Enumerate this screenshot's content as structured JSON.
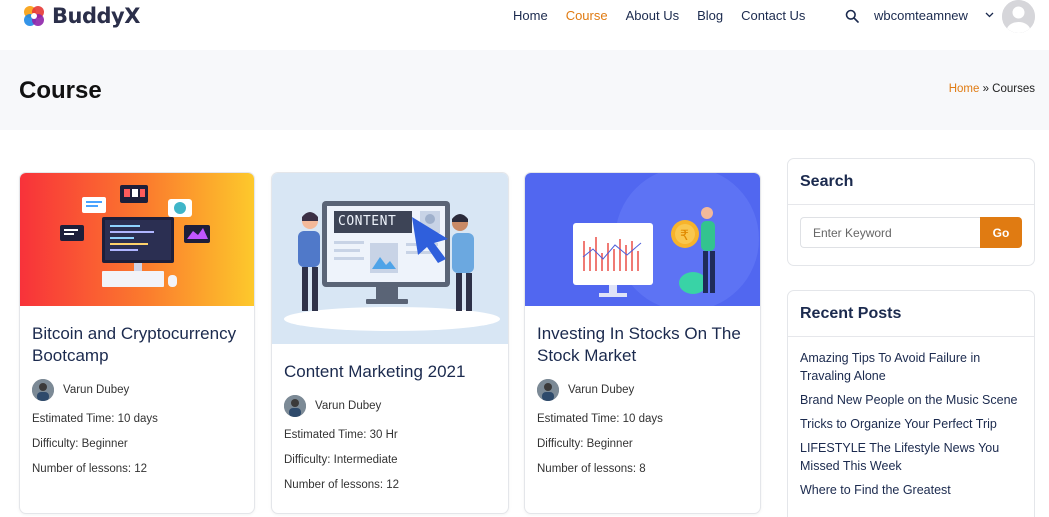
{
  "header": {
    "brand": "BuddyX",
    "nav": [
      {
        "label": "Home",
        "active": false
      },
      {
        "label": "Course",
        "active": true
      },
      {
        "label": "About Us",
        "active": false
      },
      {
        "label": "Blog",
        "active": false
      },
      {
        "label": "Contact Us",
        "active": false
      }
    ],
    "username": "wbcomteamnew"
  },
  "page": {
    "title": "Course",
    "breadcrumb_home": "Home",
    "breadcrumb_sep": " » ",
    "breadcrumb_current": "Courses"
  },
  "courses": [
    {
      "title": "Bitcoin and Cryptocurrency Bootcamp",
      "author": "Varun Dubey",
      "time": "Estimated Time: 10 days",
      "difficulty": "Difficulty: Beginner",
      "lessons": "Number of lessons: 12"
    },
    {
      "title": "Content Marketing 2021",
      "image_text": "CONTENT",
      "author": "Varun Dubey",
      "time": "Estimated Time: 30 Hr",
      "difficulty": "Difficulty: Intermediate",
      "lessons": "Number of lessons: 12"
    },
    {
      "title": "Investing In Stocks On The Stock Market",
      "author": "Varun Dubey",
      "time": "Estimated Time: 10 days",
      "difficulty": "Difficulty: Beginner",
      "lessons": "Number of lessons: 8"
    }
  ],
  "sidebar": {
    "search_title": "Search",
    "search_placeholder": "Enter Keyword",
    "go_label": "Go",
    "recent_title": "Recent Posts",
    "recent_posts": [
      "Amazing Tips To Avoid Failure in Travaling Alone",
      "Brand New People on the Music Scene",
      "Tricks to Organize Your Perfect Trip",
      "LIFESTYLE The Lifestyle News You Missed This Week",
      "Where to Find the Greatest"
    ]
  },
  "colors": {
    "accent": "#e07b12",
    "navy": "#1b2a4e"
  }
}
